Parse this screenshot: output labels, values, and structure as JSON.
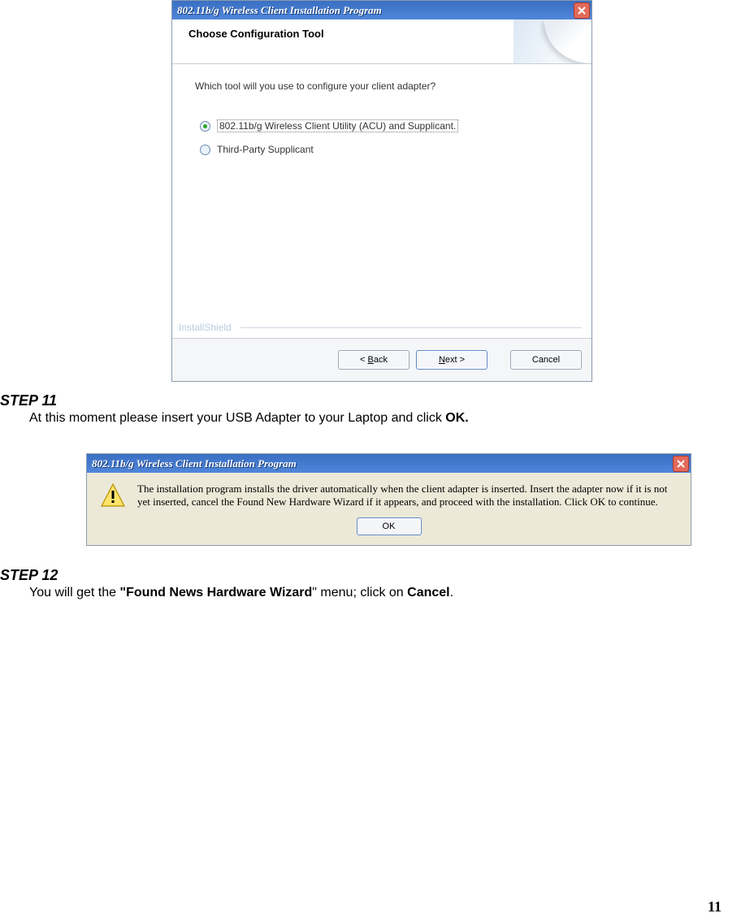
{
  "dialog1": {
    "title": "802.11b/g Wireless Client Installation Program",
    "banner_title": "Choose Configuration Tool",
    "question": "Which tool will you use to configure your client adapter?",
    "option1": "802.11b/g Wireless Client Utility (ACU) and Supplicant.",
    "option2": "Third-Party Supplicant",
    "installshield_label": "InstallShield",
    "back_label": "< Back",
    "next_label": "Next >",
    "cancel_label": "Cancel"
  },
  "step11": {
    "heading": "STEP 11",
    "text_before": "At this moment please insert your USB Adapter to your Laptop and click ",
    "bold": "OK.",
    "text_after": ""
  },
  "dialog2": {
    "title": "802.11b/g Wireless Client Installation Program",
    "message": "The installation program installs the driver automatically when the client adapter is inserted. Insert the adapter now if it is not yet inserted, cancel the Found New Hardware Wizard if it appears, and proceed with the installation. Click OK to continue.",
    "ok_label": "OK"
  },
  "step12": {
    "heading": "STEP 12",
    "text_before": "You will get the ",
    "bold": "\"Found News Hardware Wizard",
    "text_mid": "\" menu; click on ",
    "bold2": "Cancel",
    "text_after": "."
  },
  "page_number": "11"
}
